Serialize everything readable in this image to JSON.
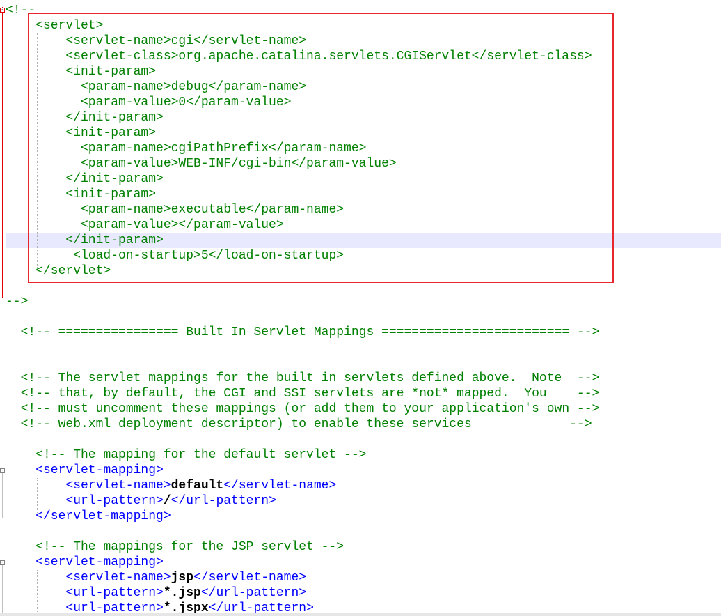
{
  "editor": {
    "lines": [
      {
        "indent": 0,
        "tokens": [
          {
            "t": "comment",
            "v": "<!--"
          }
        ]
      },
      {
        "indent": 2,
        "tokens": [
          {
            "t": "comment",
            "v": "<servlet>"
          }
        ]
      },
      {
        "indent": 4,
        "tokens": [
          {
            "t": "comment",
            "v": "<servlet-name>cgi</servlet-name>"
          }
        ]
      },
      {
        "indent": 4,
        "tokens": [
          {
            "t": "comment",
            "v": "<servlet-class>org.apache.catalina.servlets.CGIServlet</servlet-class>"
          }
        ]
      },
      {
        "indent": 4,
        "tokens": [
          {
            "t": "comment",
            "v": "<init-param>"
          }
        ]
      },
      {
        "indent": 5,
        "tokens": [
          {
            "t": "comment",
            "v": "<param-name>debug</param-name>"
          }
        ]
      },
      {
        "indent": 5,
        "tokens": [
          {
            "t": "comment",
            "v": "<param-value>0</param-value>"
          }
        ]
      },
      {
        "indent": 4,
        "tokens": [
          {
            "t": "comment",
            "v": "</init-param>"
          }
        ]
      },
      {
        "indent": 4,
        "tokens": [
          {
            "t": "comment",
            "v": "<init-param>"
          }
        ]
      },
      {
        "indent": 5,
        "tokens": [
          {
            "t": "comment",
            "v": "<param-name>cgiPathPrefix</param-name>"
          }
        ]
      },
      {
        "indent": 5,
        "tokens": [
          {
            "t": "comment",
            "v": "<param-value>WEB-INF/cgi-bin</param-value>"
          }
        ]
      },
      {
        "indent": 4,
        "tokens": [
          {
            "t": "comment",
            "v": "</init-param>"
          }
        ]
      },
      {
        "indent": 4,
        "tokens": [
          {
            "t": "comment",
            "v": "<init-param>"
          }
        ]
      },
      {
        "indent": 5,
        "tokens": [
          {
            "t": "comment",
            "v": "<param-name>executable</param-name>"
          }
        ]
      },
      {
        "indent": 5,
        "tokens": [
          {
            "t": "comment",
            "v": "<param-value></param-value>"
          }
        ]
      },
      {
        "indent": 4,
        "tokens": [
          {
            "t": "comment",
            "v": "</init-param>"
          }
        ],
        "current": true
      },
      {
        "indent": 4.5,
        "tokens": [
          {
            "t": "comment",
            "v": "<load-on-startup>5</load-on-startup>"
          }
        ]
      },
      {
        "indent": 2,
        "tokens": [
          {
            "t": "comment",
            "v": "</servlet>"
          }
        ]
      },
      {
        "indent": 0,
        "tokens": []
      },
      {
        "indent": 0,
        "tokens": [
          {
            "t": "comment",
            "v": "-->"
          }
        ]
      },
      {
        "indent": 0,
        "tokens": []
      },
      {
        "indent": 1,
        "tokens": [
          {
            "t": "comment",
            "v": "<!-- ================ Built In Servlet Mappings ========================= -->"
          }
        ]
      },
      {
        "indent": 0,
        "tokens": []
      },
      {
        "indent": 0,
        "tokens": []
      },
      {
        "indent": 1,
        "tokens": [
          {
            "t": "comment",
            "v": "<!-- The servlet mappings for the built in servlets defined above.  Note  -->"
          }
        ]
      },
      {
        "indent": 1,
        "tokens": [
          {
            "t": "comment",
            "v": "<!-- that, by default, the CGI and SSI servlets are *not* mapped.  You    -->"
          }
        ]
      },
      {
        "indent": 1,
        "tokens": [
          {
            "t": "comment",
            "v": "<!-- must uncomment these mappings (or add them to your application's own -->"
          }
        ]
      },
      {
        "indent": 1,
        "tokens": [
          {
            "t": "comment",
            "v": "<!-- web.xml deployment descriptor) to enable these services             -->"
          }
        ]
      },
      {
        "indent": 0,
        "tokens": []
      },
      {
        "indent": 2,
        "tokens": [
          {
            "t": "comment",
            "v": "<!-- The mapping for the default servlet -->"
          }
        ]
      },
      {
        "indent": 2,
        "tokens": [
          {
            "t": "tag",
            "v": "<servlet-mapping>"
          }
        ]
      },
      {
        "indent": 4,
        "tokens": [
          {
            "t": "tag",
            "v": "<servlet-name>"
          },
          {
            "t": "text",
            "v": "default"
          },
          {
            "t": "tag",
            "v": "</servlet-name>"
          }
        ]
      },
      {
        "indent": 4,
        "tokens": [
          {
            "t": "tag",
            "v": "<url-pattern>"
          },
          {
            "t": "text",
            "v": "/"
          },
          {
            "t": "tag",
            "v": "</url-pattern>"
          }
        ]
      },
      {
        "indent": 2,
        "tokens": [
          {
            "t": "tag",
            "v": "</servlet-mapping>"
          }
        ]
      },
      {
        "indent": 0,
        "tokens": []
      },
      {
        "indent": 2,
        "tokens": [
          {
            "t": "comment",
            "v": "<!-- The mappings for the JSP servlet -->"
          }
        ]
      },
      {
        "indent": 2,
        "tokens": [
          {
            "t": "tag",
            "v": "<servlet-mapping>"
          }
        ]
      },
      {
        "indent": 4,
        "tokens": [
          {
            "t": "tag",
            "v": "<servlet-name>"
          },
          {
            "t": "text",
            "v": "jsp"
          },
          {
            "t": "tag",
            "v": "</servlet-name>"
          }
        ]
      },
      {
        "indent": 4,
        "tokens": [
          {
            "t": "tag",
            "v": "<url-pattern>"
          },
          {
            "t": "text",
            "v": "*.jsp"
          },
          {
            "t": "tag",
            "v": "</url-pattern>"
          }
        ]
      },
      {
        "indent": 4,
        "tokens": [
          {
            "t": "tag",
            "v": "<url-pattern>"
          },
          {
            "t": "text",
            "v": "*.jspx"
          },
          {
            "t": "tag",
            "v": "</url-pattern>"
          }
        ]
      }
    ]
  },
  "colors": {
    "comment": "#008000",
    "tag": "#0000ff",
    "text": "#000000",
    "highlight_box": "#e8262d",
    "current_line": "#e8e8ff"
  }
}
